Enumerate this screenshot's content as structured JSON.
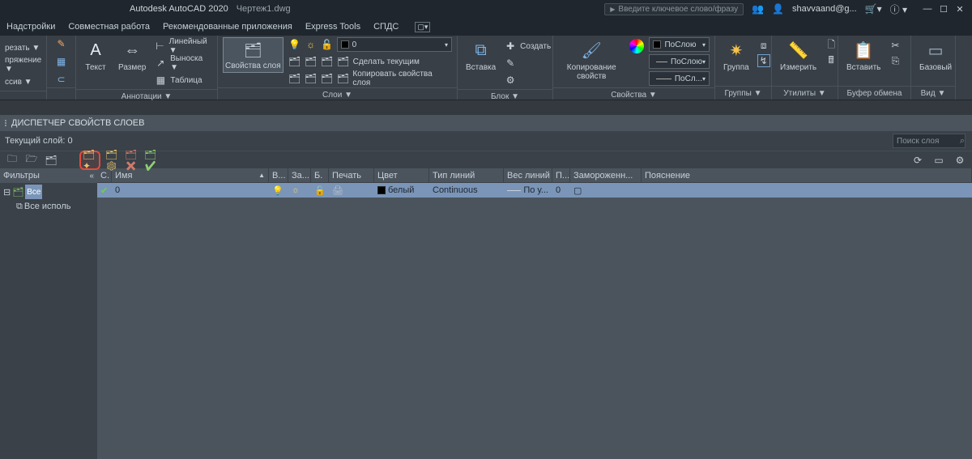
{
  "title": {
    "app": "Autodesk AutoCAD 2020",
    "file": "Чертеж1.dwg"
  },
  "topbar": {
    "search_placeholder": "Введите ключевое слово/фразу",
    "account": "shavvaand@g...",
    "help": "?"
  },
  "menubar": {
    "items": [
      "Надстройки",
      "Совместная работа",
      "Рекомендованные приложения",
      "Express Tools",
      "СПДС"
    ]
  },
  "ribbon": {
    "panels": {
      "left0": {
        "items": [
          "резать ▼",
          "пряжение ▼",
          "ссив ▼"
        ]
      },
      "annotations": {
        "label": "Аннотации ▼",
        "text": "Текст",
        "dim": "Размер",
        "linear": "Линейный ▼",
        "leader": "Выноска ▼",
        "table": "Таблица"
      },
      "layers": {
        "label": "Слои ▼",
        "props": "Свойства\nслоя",
        "dropdown_value": "0",
        "make_current": "Сделать текущим",
        "copy_props": "Копировать свойства слоя"
      },
      "block": {
        "label": "Блок ▼",
        "insert": "Вставка",
        "create": "Создать"
      },
      "propscopy": {
        "label": "Свойства ▼",
        "copy": "Копирование\nсвойств",
        "bylayer": "ПоСлою",
        "bylayer2": "ПоСлою",
        "bylayer3": "ПоСл..."
      },
      "groups": {
        "label": "Группы ▼",
        "group": "Группа"
      },
      "utilities": {
        "label": "Утилиты ▼",
        "measure": "Измерить"
      },
      "clipboard": {
        "label": "Буфер обмена",
        "paste": "Вставить"
      },
      "view": {
        "label": "Вид ▼",
        "base": "Базовый"
      }
    }
  },
  "layer_panel": {
    "title": "ДИСПЕТЧЕР СВОЙСТВ СЛОЕВ",
    "current": "Текущий слой: 0",
    "search_placeholder": "Поиск слоя",
    "filters_label": "Фильтры",
    "collapse": "«",
    "tree": {
      "all": "Все",
      "used": "Все исполь"
    },
    "columns": {
      "status": "С.",
      "name": "Имя",
      "on": "В...",
      "freeze": "За...",
      "lock": "Б.",
      "print": "Печать",
      "color": "Цвет",
      "linetype": "Тип линий",
      "lineweight": "Вес линий",
      "transp": "П...",
      "plotfrz": "Замороженн...",
      "desc": "Пояснение"
    },
    "rows": [
      {
        "name": "0",
        "color": "белый",
        "linetype": "Continuous",
        "lineweight": "По у...",
        "transp": "0"
      }
    ]
  }
}
